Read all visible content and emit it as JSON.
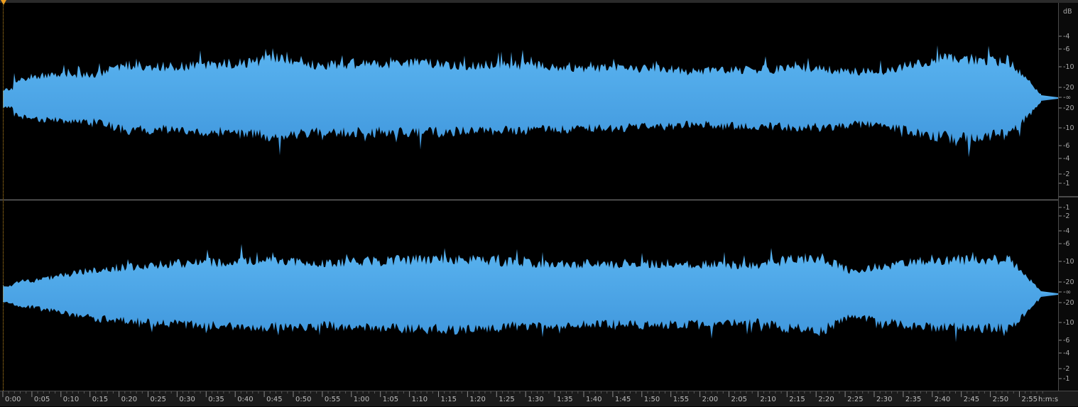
{
  "app": {
    "accent_color": "#f0a020",
    "waveform_color": "#4aa3e6",
    "background_color": "#000000"
  },
  "db_ruler": {
    "unit": "dB",
    "top_channel": [
      "-4",
      "-6",
      "-10",
      "-20",
      "-∞",
      "-20",
      "-10",
      "-6",
      "-4",
      "-2",
      "-1"
    ],
    "bottom_channel": [
      "-1",
      "-2",
      "-4",
      "-6",
      "-10",
      "-20",
      "-∞",
      "-20",
      "-10",
      "-6",
      "-4",
      "-2",
      "-1"
    ]
  },
  "time_ruler": {
    "unit": "h:m:s",
    "labels": [
      "0:00",
      "0:05",
      "0:10",
      "0:15",
      "0:20",
      "0:25",
      "0:30",
      "0:35",
      "0:40",
      "0:45",
      "0:50",
      "0:55",
      "1:00",
      "1:05",
      "1:10",
      "1:15",
      "1:20",
      "1:25",
      "1:30",
      "1:35",
      "1:40",
      "1:45",
      "1:50",
      "1:55",
      "2:00",
      "2:05",
      "2:10",
      "2:15",
      "2:20",
      "2:25",
      "2:30",
      "2:35",
      "2:40",
      "2:45",
      "2:50",
      "2:55"
    ]
  },
  "channels": [
    {
      "name": "top",
      "envelope": [
        0.18,
        0.3,
        0.31,
        0.33,
        0.45,
        0.42,
        0.44,
        0.47,
        0.5,
        0.55,
        0.45,
        0.47,
        0.45,
        0.48,
        0.46,
        0.44,
        0.45,
        0.44,
        0.42,
        0.41,
        0.4,
        0.39,
        0.36,
        0.38,
        0.38,
        0.4,
        0.4,
        0.36,
        0.36,
        0.48,
        0.54,
        0.52,
        0.5,
        0.05
      ]
    },
    {
      "name": "bottom",
      "envelope": [
        0.15,
        0.18,
        0.26,
        0.34,
        0.37,
        0.4,
        0.42,
        0.44,
        0.45,
        0.44,
        0.43,
        0.44,
        0.45,
        0.47,
        0.48,
        0.47,
        0.44,
        0.42,
        0.41,
        0.4,
        0.42,
        0.42,
        0.41,
        0.4,
        0.39,
        0.47,
        0.5,
        0.3,
        0.38,
        0.44,
        0.45,
        0.46,
        0.47,
        0.04
      ]
    }
  ]
}
